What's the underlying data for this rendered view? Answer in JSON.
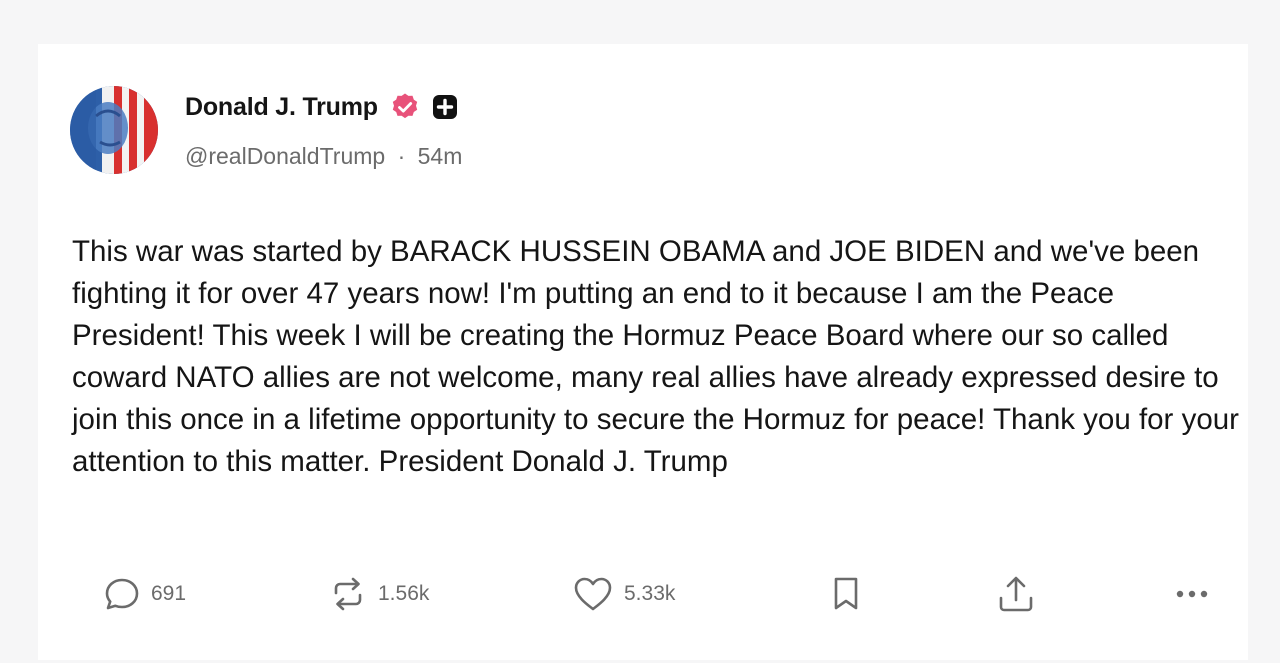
{
  "post": {
    "author": {
      "display_name": "Donald J. Trump",
      "handle": "@realDonaldTrump",
      "time_ago": "54m",
      "separator": "·"
    },
    "text": "This war was started by BARACK HUSSEIN OBAMA and JOE BIDEN and we've been fighting it for over 47 years now! I'm putting an end to it because I am the Peace President! This week I will be creating the Hormuz Peace Board where our so called coward NATO allies are not welcome, many real allies have already expressed desire to join this once in a lifetime opportunity to secure the Hormuz for peace! Thank you for your attention to this matter. President Donald J. Trump",
    "stats": {
      "replies": "691",
      "reposts": "1.56k",
      "likes": "5.33k"
    }
  },
  "icons": {
    "verified": "verified-badge-icon",
    "plus": "plus-badge-icon",
    "reply": "reply-icon",
    "repost": "repost-icon",
    "like": "heart-icon",
    "bookmark": "bookmark-icon",
    "share": "share-icon",
    "more": "more-icon"
  },
  "colors": {
    "verified_badge": "#e8527a",
    "icon_gray": "#6b6b6b",
    "text": "#151515"
  }
}
